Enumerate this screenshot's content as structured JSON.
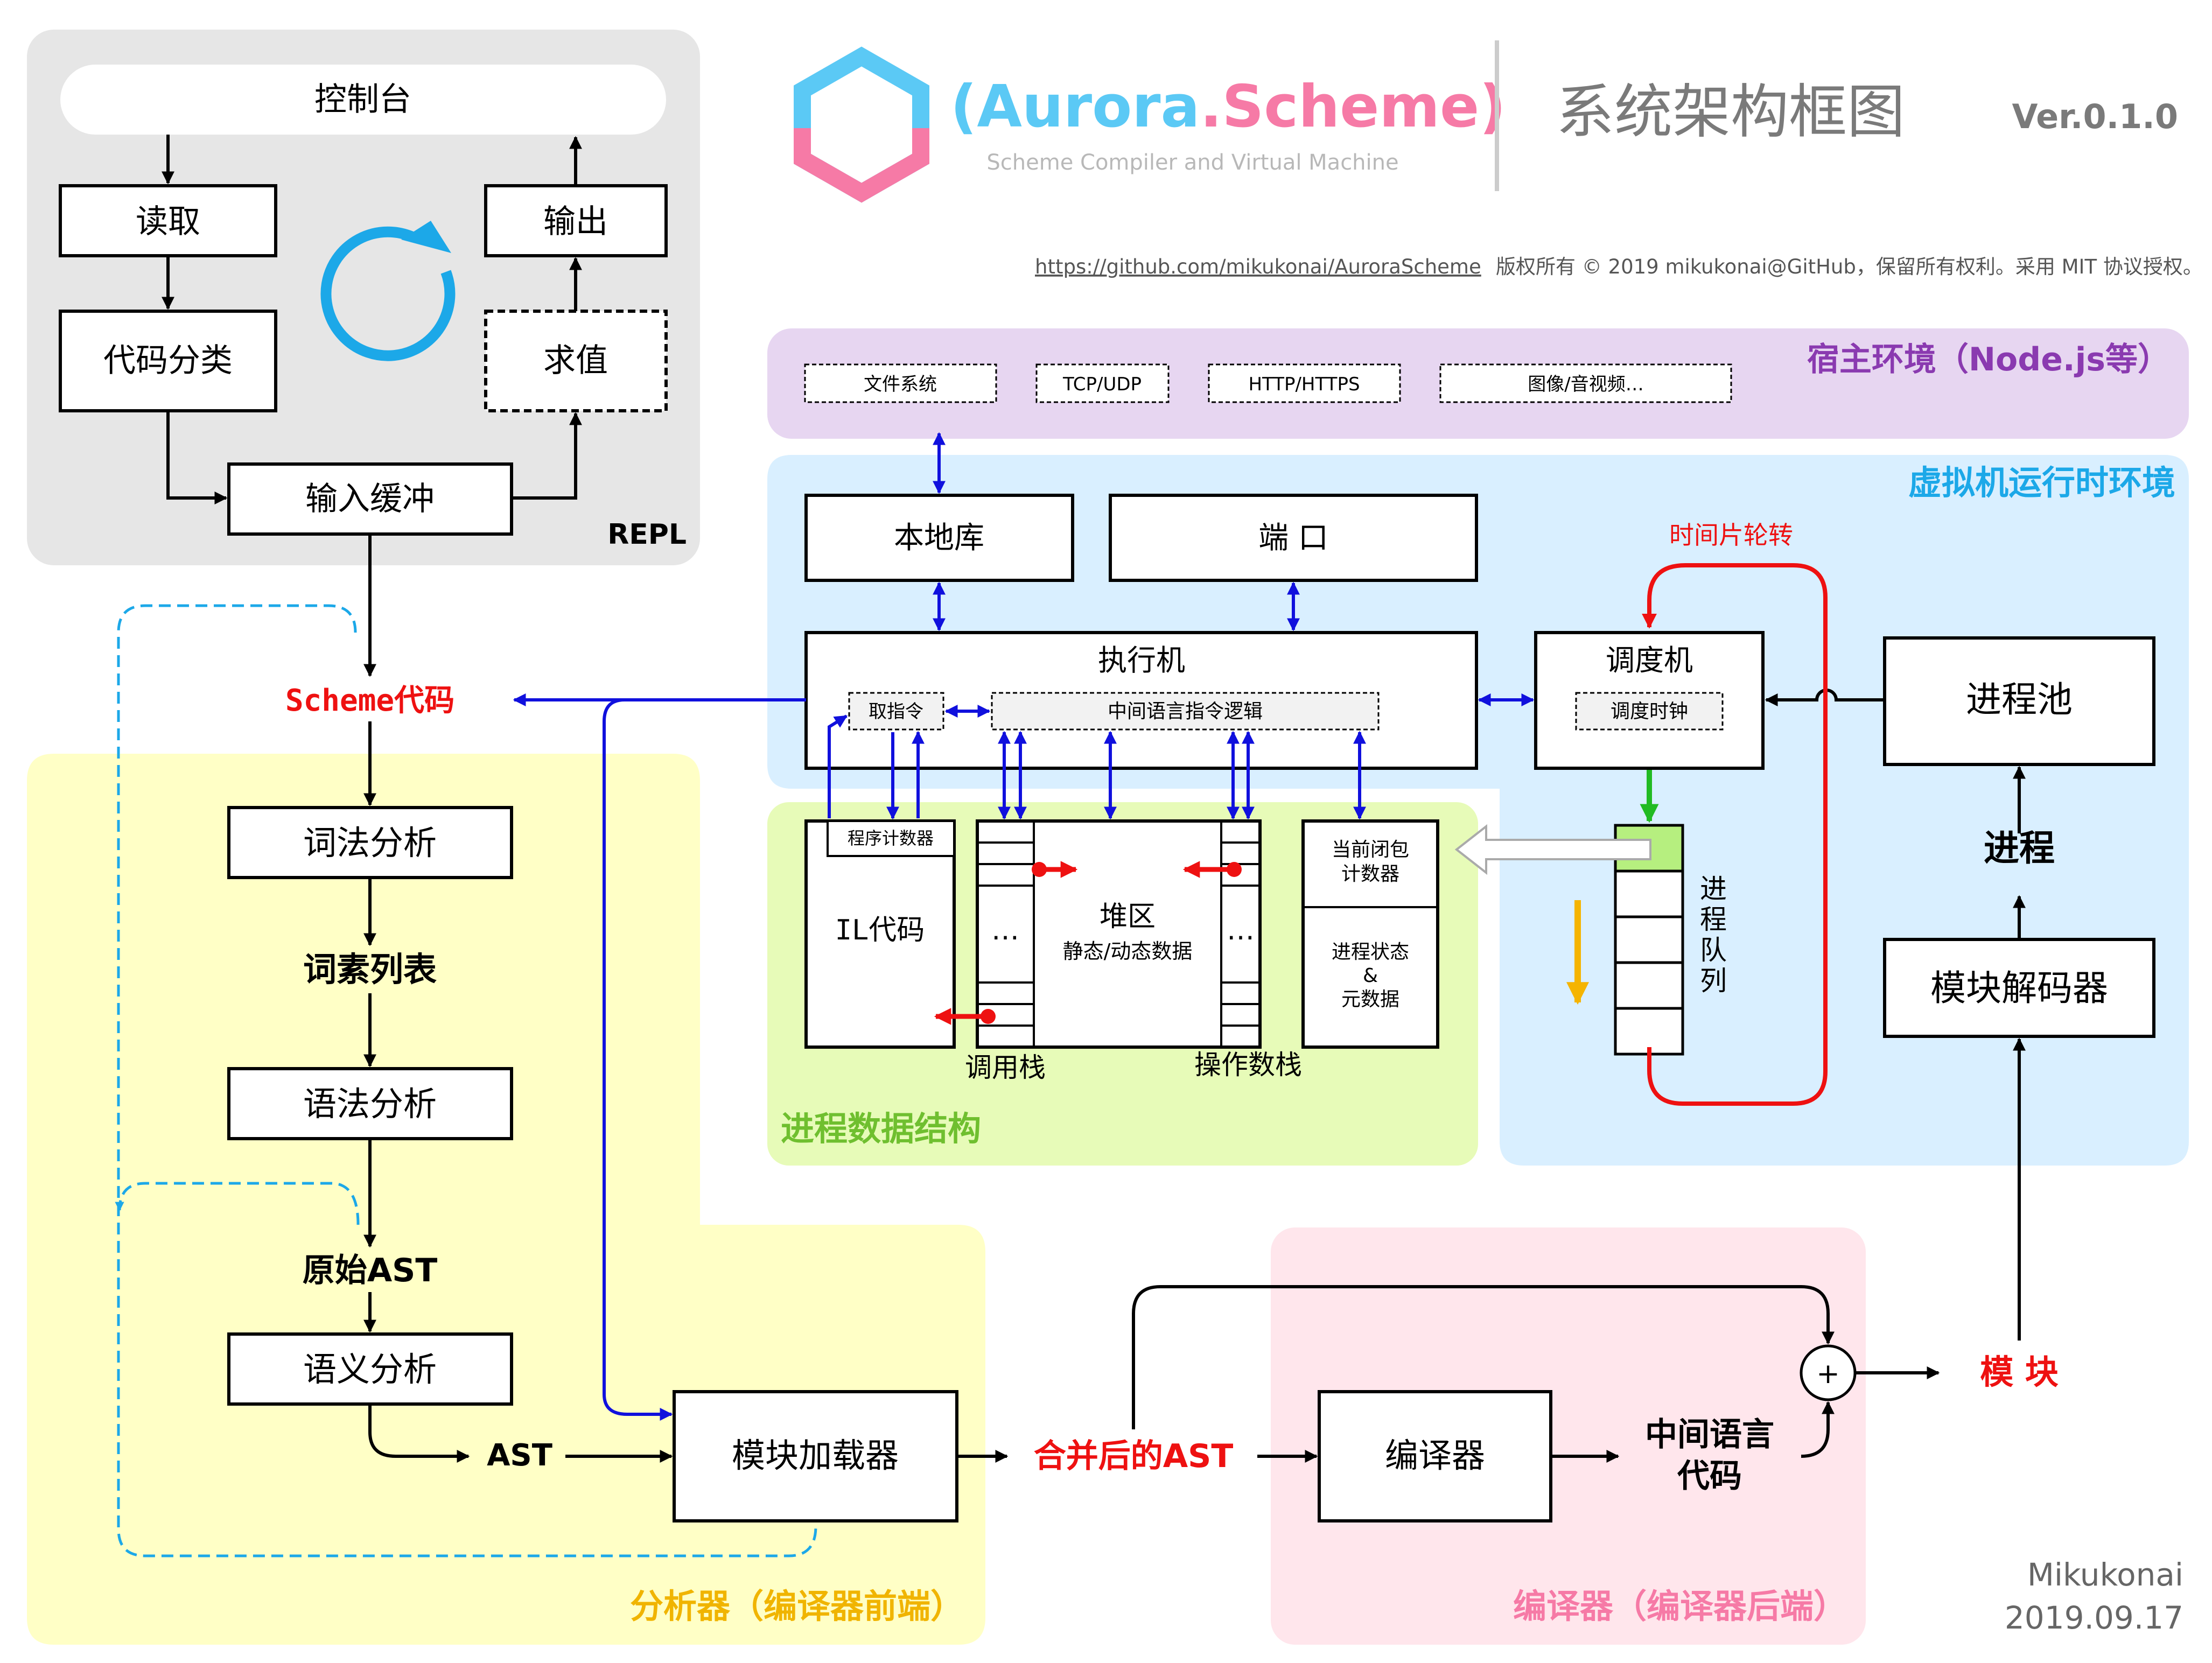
{
  "header": {
    "logo_open": "(",
    "logo_word1": "Aurora",
    "logo_dot": ".",
    "logo_word2": "Scheme",
    "logo_close": ")",
    "subtitle": "Scheme Compiler and Virtual Machine",
    "title": "系统架构框图",
    "version": "Ver.0.1.0",
    "repo_url": "https://github.com/mikukonai/AuroraScheme",
    "copyright": "版权所有 © 2019 mikukonai@GitHub，保留所有权利。采用 MIT 协议授权。"
  },
  "repl": {
    "label": "REPL",
    "console": "控制台",
    "read": "读取",
    "classify": "代码分类",
    "input_buffer": "输入缓冲",
    "evaluate": "求值",
    "output": "输出"
  },
  "analyzer": {
    "label": "分析器（编译器前端）",
    "scheme_code": "Scheme代码",
    "lexer": "词法分析",
    "token_list": "词素列表",
    "parser": "语法分析",
    "raw_ast": "原始AST",
    "semantic": "语义分析",
    "ast": "AST",
    "module_loader": "模块加载器"
  },
  "merged_ast": "合并后的AST",
  "compiler": {
    "label": "编译器（编译器后端）",
    "compiler": "编译器",
    "il_line1": "中间语言",
    "il_line2": "代码",
    "plus": "+",
    "module": "模 块"
  },
  "host": {
    "label": "宿主环境（Node.js等）",
    "items": [
      "文件系统",
      "TCP/UDP",
      "HTTP/HTTPS",
      "图像/音视频…"
    ]
  },
  "vm": {
    "label": "虚拟机运行时环境",
    "local_lib": "本地库",
    "port": "端 口",
    "executor": "执行机",
    "fetch": "取指令",
    "il_logic": "中间语言指令逻辑",
    "scheduler": "调度机",
    "sched_clock": "调度时钟",
    "time_slice": "时间片轮转",
    "process_pool": "进程池",
    "process": "进程",
    "module_decoder": "模块解码器",
    "process_queue": [
      "进",
      "程",
      "队",
      "列"
    ]
  },
  "proc_data": {
    "label": "进程数据结构",
    "pc": "程序计数器",
    "il_code": "IL代码",
    "heap": "堆区",
    "heap_sub": "静态/动态数据",
    "dots": "…",
    "call_stack": "调用栈",
    "operand_stack": "操作数栈",
    "closure_line1": "当前闭包",
    "closure_line2": "计数器",
    "state_line1": "进程状态",
    "state_line2": "&",
    "state_line3": "元数据"
  },
  "footer": {
    "author": "Mikukonai",
    "date": "2019.09.17"
  },
  "colors": {
    "repl_bg": "#e6e6e6",
    "analyzer_bg": "#ffffc6",
    "compiler_bg": "#ffe6ec",
    "host_bg": "#e7d6f1",
    "vm_bg": "#d9efff",
    "proc_bg": "#e7fbb8",
    "red": "#ee1111",
    "blue": "#1010dd",
    "green": "#22bb22",
    "orange": "#f5b400",
    "cyan": "#1ca8e8",
    "pink": "#f67aa6",
    "purple": "#8a3ab0",
    "gold": "#f0b400",
    "lime_green": "#6fbf2f"
  }
}
